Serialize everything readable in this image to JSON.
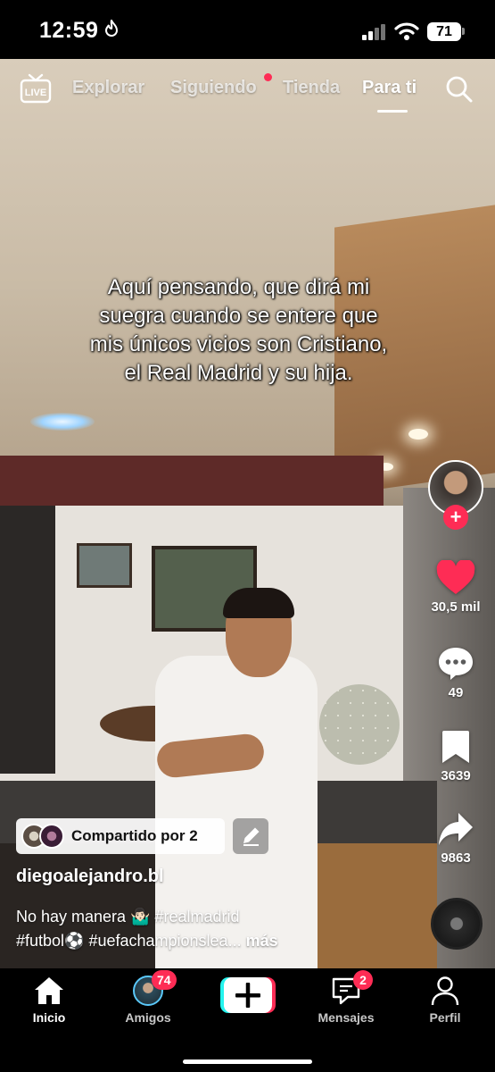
{
  "status_bar": {
    "time": "12:59",
    "battery": "71"
  },
  "top_nav": {
    "tabs": [
      {
        "label": "Explorar"
      },
      {
        "label": "Siguiendo"
      },
      {
        "label": "Tienda"
      },
      {
        "label": "Para ti"
      }
    ],
    "active_tab": "Para ti",
    "live_icon": "live-icon",
    "search_icon": "search-icon"
  },
  "video": {
    "overlay_text": "Aquí pensando, que dirá mi suegra cuando se entere que mis únicos vicios son Cristiano, el Real Madrid y su hija."
  },
  "actions": {
    "likes": "30,5 mil",
    "comments": "49",
    "bookmarks": "3639",
    "shares": "9863"
  },
  "post": {
    "shared_by": "Compartido por 2",
    "username": "diegoalejandro.bl",
    "description_text": "No hay manera 🤷🏻‍♂️ #realmadrid",
    "description_line2": "#futbol⚽ #uefachampionslea...",
    "more_label": "más"
  },
  "tab_bar": {
    "home": "Inicio",
    "friends": "Amigos",
    "friends_badge": "74",
    "messages": "Mensajes",
    "messages_badge": "2",
    "profile": "Perfil"
  },
  "colors": {
    "accent": "#fe2c55",
    "like": "#fe2c55",
    "create_left": "#25f4ee",
    "create_right": "#fe2c55"
  }
}
